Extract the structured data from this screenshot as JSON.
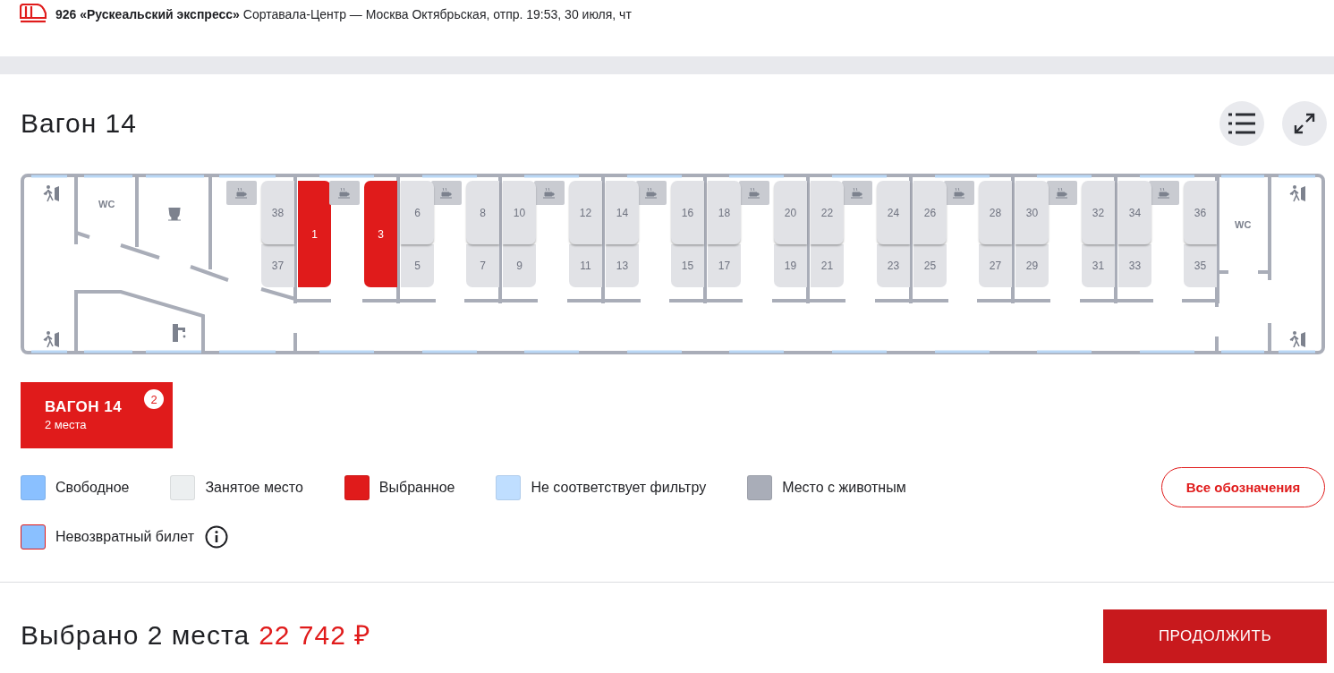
{
  "header": {
    "route": "**926 «Рускеальский экспресс»** Сортавала-Центр — Москва Октябрьская, отпр. 19:53, 30 июля, чт"
  },
  "car": {
    "title": "Вагон 14"
  },
  "car_map": {
    "wc_labels": [
      "WC",
      "WC"
    ],
    "compartments": [
      {
        "left": [
          {
            "number": "38",
            "selected": false
          },
          {
            "number": "37",
            "selected": false
          }
        ],
        "right": [
          {
            "number": "1",
            "selected": true
          }
        ]
      },
      {
        "left": [
          {
            "number": "3",
            "selected": true
          }
        ],
        "right": [
          {
            "number": "6",
            "selected": false
          },
          {
            "number": "5",
            "selected": false
          }
        ]
      },
      {
        "left": [
          {
            "number": "8",
            "selected": false
          },
          {
            "number": "7",
            "selected": false
          }
        ],
        "right": [
          {
            "number": "10",
            "selected": false
          },
          {
            "number": "9",
            "selected": false
          }
        ]
      },
      {
        "left": [
          {
            "number": "12",
            "selected": false
          },
          {
            "number": "11",
            "selected": false
          }
        ],
        "right": [
          {
            "number": "14",
            "selected": false
          },
          {
            "number": "13",
            "selected": false
          }
        ]
      },
      {
        "left": [
          {
            "number": "16",
            "selected": false
          },
          {
            "number": "15",
            "selected": false
          }
        ],
        "right": [
          {
            "number": "18",
            "selected": false
          },
          {
            "number": "17",
            "selected": false
          }
        ]
      },
      {
        "left": [
          {
            "number": "20",
            "selected": false
          },
          {
            "number": "19",
            "selected": false
          }
        ],
        "right": [
          {
            "number": "22",
            "selected": false
          },
          {
            "number": "21",
            "selected": false
          }
        ]
      },
      {
        "left": [
          {
            "number": "24",
            "selected": false
          },
          {
            "number": "23",
            "selected": false
          }
        ],
        "right": [
          {
            "number": "26",
            "selected": false
          },
          {
            "number": "25",
            "selected": false
          }
        ]
      },
      {
        "left": [
          {
            "number": "28",
            "selected": false
          },
          {
            "number": "27",
            "selected": false
          }
        ],
        "right": [
          {
            "number": "30",
            "selected": false
          },
          {
            "number": "29",
            "selected": false
          }
        ]
      },
      {
        "left": [
          {
            "number": "32",
            "selected": false
          },
          {
            "number": "31",
            "selected": false
          }
        ],
        "right": [
          {
            "number": "34",
            "selected": false
          },
          {
            "number": "33",
            "selected": false
          }
        ]
      },
      {
        "left": [
          {
            "number": "36",
            "selected": false
          },
          {
            "number": "35",
            "selected": false
          }
        ]
      }
    ]
  },
  "car_tabs": [
    {
      "label": "ВАГОН 14",
      "seats": "2 места",
      "badge": "2",
      "selected": true
    }
  ],
  "legend": [
    {
      "label": "Свободное",
      "color": "#8ac0ff",
      "kind": "plain",
      "info": false
    },
    {
      "label": "Занятое место",
      "color": "#eceff0",
      "kind": "plain",
      "info": false
    },
    {
      "label": "Выбранное",
      "color": "#e01b1b",
      "kind": "plain",
      "info": false
    },
    {
      "label": "Не соответствует фильтру",
      "color": "#bfdeff",
      "kind": "plain",
      "info": false
    },
    {
      "label": "Место с животным",
      "color": "#a9adb8",
      "kind": "plain",
      "info": false
    },
    {
      "label": "Невозвратный билет",
      "color": "#8ac0ff",
      "kind": "nonrefundable",
      "info": true
    }
  ],
  "all_legend_button": "Все обозначения",
  "footer": {
    "summary": "Выбрано 2 места",
    "price": "22 742 ₽",
    "continue_button": "ПРОДОЛЖИТЬ"
  }
}
